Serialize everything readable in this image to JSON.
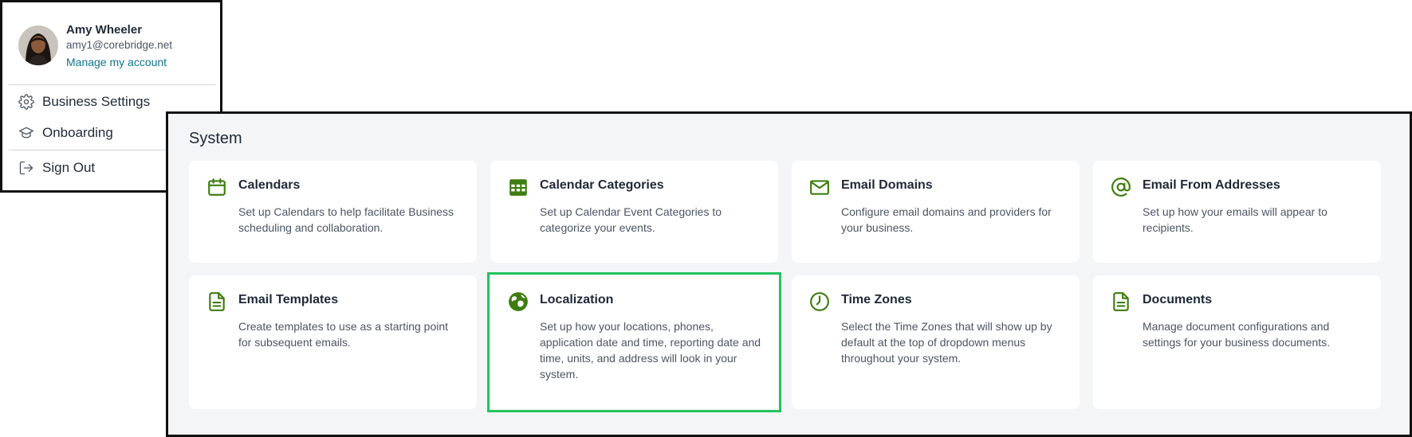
{
  "account": {
    "name": "Amy Wheeler",
    "email": "amy1@corebridge.net",
    "manage_label": "Manage my account",
    "menu": [
      {
        "label": "Business Settings",
        "icon": "gear-icon"
      },
      {
        "label": "Onboarding",
        "icon": "graduation-cap-icon"
      },
      {
        "label": "Sign Out",
        "icon": "sign-out-icon"
      }
    ]
  },
  "system": {
    "title": "System",
    "accent_color": "#3f7d10",
    "selected_color": "#22c55e",
    "cards": [
      {
        "title": "Calendars",
        "icon": "calendar-icon",
        "description": "Set up Calendars to help facilitate Business scheduling and collaboration."
      },
      {
        "title": "Calendar Categories",
        "icon": "calendar-grid-icon",
        "description": "Set up Calendar Event Categories to categorize your events."
      },
      {
        "title": "Email Domains",
        "icon": "envelope-icon",
        "description": "Configure email domains and providers for your business."
      },
      {
        "title": "Email From Addresses",
        "icon": "at-sign-icon",
        "description": "Set up how your emails will appear to recipients."
      },
      {
        "title": "Email Templates",
        "icon": "document-icon",
        "description": "Create templates to use as a starting point for subsequent emails."
      },
      {
        "title": "Localization",
        "icon": "globe-icon",
        "description": "Set up how your locations, phones, application date and time, reporting date and time, units, and address will look in your system.",
        "selected": true
      },
      {
        "title": "Time Zones",
        "icon": "clock-icon",
        "description": "Select the Time Zones that will show up by default at the top of dropdown menus throughout your system."
      },
      {
        "title": "Documents",
        "icon": "document-icon",
        "description": "Manage document configurations and settings for your business documents."
      }
    ]
  }
}
